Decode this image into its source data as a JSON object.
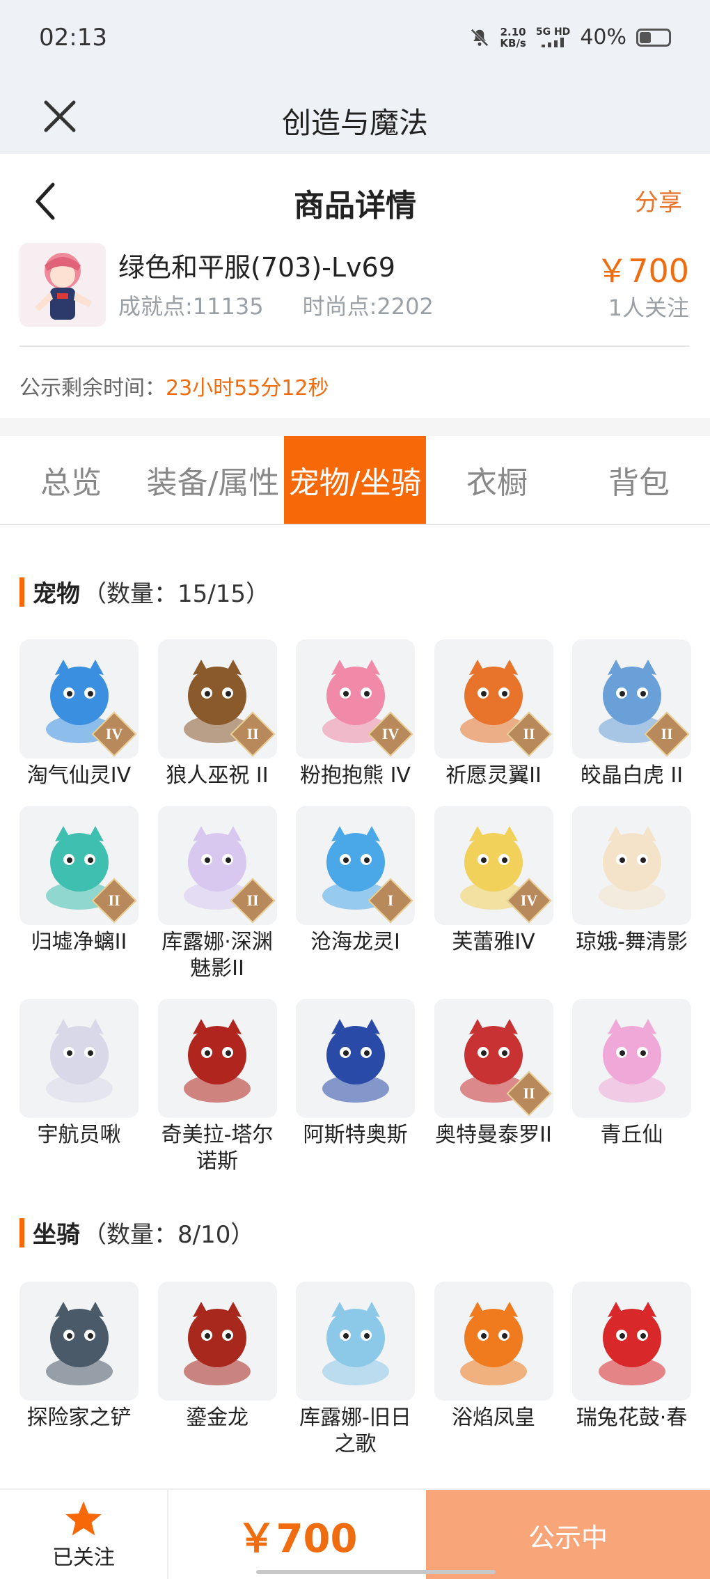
{
  "status_bar": {
    "time": "02:13",
    "net_speed_value": "2.10",
    "net_speed_unit": "KB/s",
    "signal": "5G HD",
    "battery": "40%",
    "battery_level": 0.4
  },
  "app": {
    "title": "创造与魔法"
  },
  "detail": {
    "title": "商品详情",
    "share": "分享"
  },
  "product": {
    "name": "绿色和平服(703)-Lv69",
    "achievement": "成就点:11135",
    "fashion": "时尚点:2202",
    "price": "￥700",
    "followers": "1人关注",
    "countdown_label": "公示剩余时间：",
    "countdown_value": "23小时55分12秒"
  },
  "tabs": [
    {
      "label": "总览",
      "active": false
    },
    {
      "label": "装备/属性",
      "active": false
    },
    {
      "label": "宠物/坐骑",
      "active": true
    },
    {
      "label": "衣橱",
      "active": false
    },
    {
      "label": "背包",
      "active": false
    }
  ],
  "pets": {
    "title": "宠物",
    "count": "（数量：15/15）",
    "items": [
      {
        "name": "淘气仙灵IV",
        "level": "IV",
        "icon": "blue-dog-pet",
        "color": "#3a8fe0"
      },
      {
        "name": "狼人巫祝 II",
        "level": "II",
        "icon": "werewolf-pet",
        "color": "#8a5a2b"
      },
      {
        "name": "粉抱抱熊 IV",
        "level": "IV",
        "icon": "pink-bear-pet",
        "color": "#f08aa8"
      },
      {
        "name": "祈愿灵翼II",
        "level": "II",
        "icon": "phoenix-bird-pet",
        "color": "#e8742c"
      },
      {
        "name": "皎晶白虎 II",
        "level": "II",
        "icon": "white-tiger-pet",
        "color": "#6aa0d8"
      },
      {
        "name": "归墟净螭II",
        "level": "II",
        "icon": "jade-dragon-pet",
        "color": "#3fbfb0"
      },
      {
        "name": "库露娜·深渊魅影II",
        "level": "II",
        "icon": "kuluna-pet",
        "color": "#d8c8f0"
      },
      {
        "name": "沧海龙灵I",
        "level": "I",
        "icon": "sea-dragon-spirit-pet",
        "color": "#4aa8e8"
      },
      {
        "name": "芙蕾雅IV",
        "level": "IV",
        "icon": "freya-pet",
        "color": "#f2d15a"
      },
      {
        "name": "琼娥-舞清影",
        "level": "",
        "icon": "chang-e-pet",
        "color": "#f4e3c8"
      },
      {
        "name": "宇航员啾",
        "level": "",
        "icon": "astronaut-pet",
        "color": "#d8d8e8"
      },
      {
        "name": "奇美拉-塔尔诺斯",
        "level": "",
        "icon": "chimera-pet",
        "color": "#b0261e"
      },
      {
        "name": "阿斯特奥斯",
        "level": "",
        "icon": "asteros-pet",
        "color": "#2a4aa8"
      },
      {
        "name": "奥特曼泰罗II",
        "level": "II",
        "icon": "ultraman-taro-pet",
        "color": "#c83232"
      },
      {
        "name": "青丘仙",
        "level": "",
        "icon": "fox-fairy-pet",
        "color": "#f0a8d8"
      }
    ]
  },
  "mounts": {
    "title": "坐骑",
    "count": "（数量：8/10）",
    "items": [
      {
        "name": "探险家之铲",
        "icon": "shovel-mount",
        "color": "#4a5a68"
      },
      {
        "name": "鎏金龙",
        "icon": "gold-dragon-mount",
        "color": "#a8281e"
      },
      {
        "name": "库露娜-旧日之歌",
        "icon": "kuluna-song-mount",
        "color": "#8cc8e8"
      },
      {
        "name": "浴焰凤皇",
        "icon": "flame-phoenix-mount",
        "color": "#f07a1e"
      },
      {
        "name": "瑞兔花鼓·春",
        "icon": "rabbit-drum-mount",
        "color": "#d8282a"
      }
    ]
  },
  "bottom_bar": {
    "follow_label": "已关注",
    "price": "￥700",
    "status": "公示中"
  },
  "colors": {
    "accent": "#f76808",
    "price": "#ef6c10",
    "status_button": "#f9a57a"
  }
}
